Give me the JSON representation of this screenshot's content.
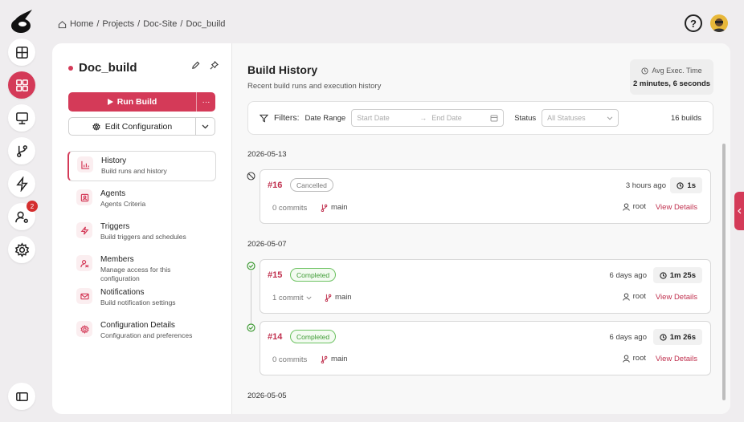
{
  "breadcrumb": {
    "home": "Home",
    "sep": "/",
    "projects": "Projects",
    "site": "Doc-Site",
    "current": "Doc_build"
  },
  "rail": {
    "items": [
      "dashboard-icon",
      "projects-icon",
      "monitor-icon",
      "branch-icon",
      "bolt-icon",
      "users-icon",
      "gear-icon"
    ],
    "notifications": "2"
  },
  "sidebar": {
    "title": "Doc_build",
    "run_label": "Run Build",
    "more_label": "···",
    "edit_label": "Edit Configuration",
    "nav": [
      {
        "title": "History",
        "sub": "Build runs and history"
      },
      {
        "title": "Agents",
        "sub": "Agents Criteria"
      },
      {
        "title": "Triggers",
        "sub": "Build triggers and schedules"
      },
      {
        "title": "Members",
        "sub": "Manage access for this configuration"
      },
      {
        "title": "Notifications",
        "sub": "Build notification settings"
      },
      {
        "title": "Configuration Details",
        "sub": "Configuration and preferences"
      }
    ]
  },
  "content": {
    "title": "Build History",
    "subtitle": "Recent build runs and execution history",
    "avg_label": "Avg Exec. Time",
    "avg_value": "2 minutes, 6 seconds",
    "filters": {
      "label": "Filters:",
      "date_range": "Date Range",
      "start": "Start Date",
      "arrow": "→",
      "end": "End Date",
      "status_label": "Status",
      "status_placeholder": "All Statuses",
      "count": "16 builds"
    },
    "dates": [
      "2026-05-13",
      "2026-05-07",
      "2026-05-05"
    ],
    "builds": [
      {
        "id": "#16",
        "status": "Cancelled",
        "ago": "3 hours ago",
        "duration": "1s",
        "commits": "0 commits",
        "branch": "main",
        "user": "root",
        "details": "View Details"
      },
      {
        "id": "#15",
        "status": "Completed",
        "ago": "6 days ago",
        "duration": "1m 25s",
        "commits": "1 commit",
        "branch": "main",
        "user": "root",
        "details": "View Details"
      },
      {
        "id": "#14",
        "status": "Completed",
        "ago": "6 days ago",
        "duration": "1m 26s",
        "commits": "0 commits",
        "branch": "main",
        "user": "root",
        "details": "View Details"
      }
    ]
  },
  "colors": {
    "accent": "#d43a58",
    "success": "#3e9b34"
  }
}
